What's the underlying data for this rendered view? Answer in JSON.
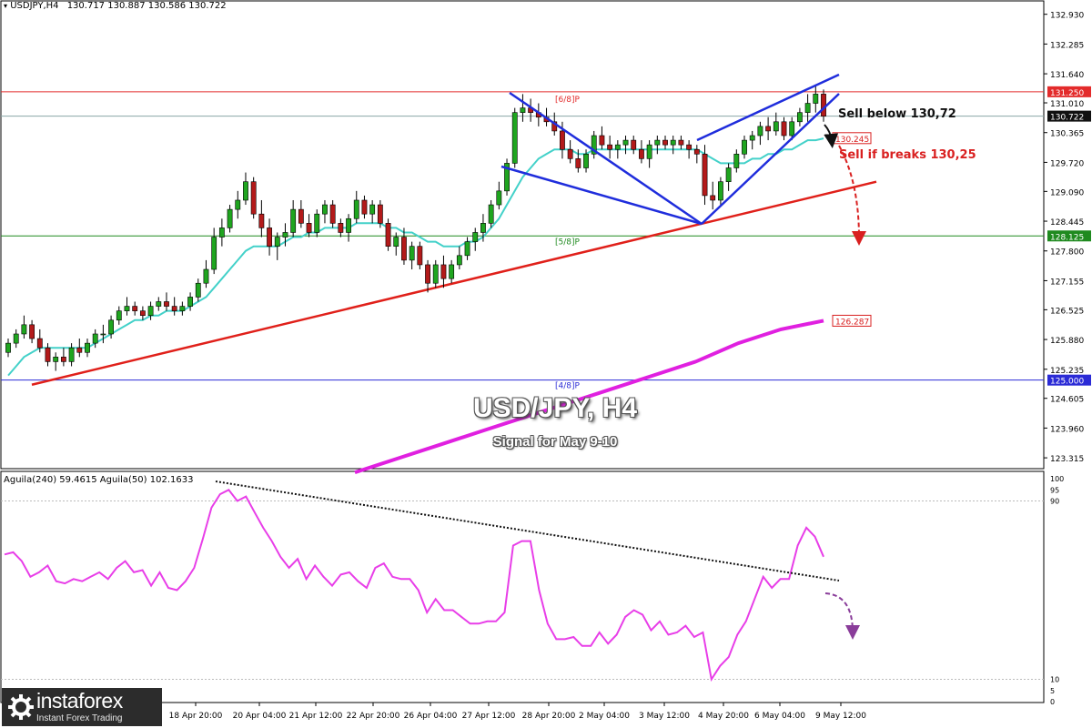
{
  "header": {
    "symbol": "USDJPY,H4",
    "ohlc": "130.717 130.887 130.586 130.722",
    "indicator_header": "Aguila(240) 59.4615  Aguila(50) 102.1633"
  },
  "watermark": {
    "title": "USD/JPY, H4",
    "subtitle": "Signal for May 9-10"
  },
  "logo": {
    "name": "instaforex",
    "tagline": "Instant Forex Trading"
  },
  "annotations": {
    "sell_below": "Sell below 130,72",
    "sell_if_breaks": "Sell if breaks 130,25"
  },
  "colors": {
    "resistance_line": "#e32b2b",
    "support_line": "#1f8a1f",
    "level_4_8": "#2b2bd6",
    "ema_fast": "#43d1c9",
    "ema_slow": "#e020e0",
    "wedge": "#1f2ddc",
    "trendline": "#e0201a",
    "candle_up": "#1fa51f",
    "candle_down": "#b31a1a",
    "oscillator": "#e83ee8",
    "annotation_red": "#d92020"
  },
  "chart_data": [
    {
      "type": "candlestick",
      "symbol": "USDJPY",
      "timeframe": "H4",
      "ylim": [
        123.1,
        133.2
      ],
      "y_ticks": [
        "132.930",
        "132.285",
        "131.640",
        "131.010",
        "130.365",
        "129.720",
        "129.090",
        "128.445",
        "127.800",
        "127.155",
        "126.525",
        "125.880",
        "125.235",
        "124.605",
        "123.960",
        "123.315"
      ],
      "x_ticks": [
        "18 Apr 20:00",
        "20 Apr 04:00",
        "21 Apr 12:00",
        "22 Apr 20:00",
        "26 Apr 04:00",
        "27 Apr 12:00",
        "28 Apr 20:00",
        "2 May 04:00",
        "3 May 12:00",
        "4 May 20:00",
        "6 May 04:00",
        "9 May 12:00"
      ],
      "levels": [
        {
          "name": "[6/8]P",
          "value": 131.25,
          "label": "131.250"
        },
        {
          "name": "[5/8]P",
          "value": 128.125,
          "label": "128.125"
        },
        {
          "name": "[4/8]P",
          "value": 125.0,
          "label": "125.000"
        }
      ],
      "price_labels": [
        {
          "value": 130.722,
          "label": "130.722"
        },
        {
          "value": 130.245,
          "label": "130.245"
        },
        {
          "value": 126.287,
          "label": "126.287"
        }
      ],
      "ohlc": [
        [
          125.6,
          125.9,
          125.5,
          125.8
        ],
        [
          125.8,
          126.1,
          125.7,
          126.0
        ],
        [
          126.0,
          126.4,
          125.9,
          126.2
        ],
        [
          126.2,
          126.3,
          125.8,
          125.9
        ],
        [
          125.9,
          126.1,
          125.6,
          125.7
        ],
        [
          125.7,
          125.8,
          125.3,
          125.4
        ],
        [
          125.4,
          125.6,
          125.2,
          125.5
        ],
        [
          125.5,
          125.7,
          125.3,
          125.4
        ],
        [
          125.4,
          125.8,
          125.3,
          125.7
        ],
        [
          125.7,
          125.9,
          125.5,
          125.6
        ],
        [
          125.6,
          125.9,
          125.5,
          125.8
        ],
        [
          125.8,
          126.1,
          125.7,
          126.0
        ],
        [
          126.0,
          126.2,
          125.8,
          126.0
        ],
        [
          126.0,
          126.4,
          125.9,
          126.3
        ],
        [
          126.3,
          126.6,
          126.2,
          126.5
        ],
        [
          126.5,
          126.8,
          126.4,
          126.6
        ],
        [
          126.6,
          126.7,
          126.4,
          126.5
        ],
        [
          126.5,
          126.6,
          126.3,
          126.4
        ],
        [
          126.4,
          126.7,
          126.3,
          126.6
        ],
        [
          126.6,
          126.8,
          126.5,
          126.7
        ],
        [
          126.7,
          126.9,
          126.5,
          126.6
        ],
        [
          126.6,
          126.8,
          126.4,
          126.5
        ],
        [
          126.5,
          126.7,
          126.4,
          126.6
        ],
        [
          126.6,
          126.9,
          126.5,
          126.8
        ],
        [
          126.8,
          127.2,
          126.7,
          127.1
        ],
        [
          127.1,
          127.6,
          127.0,
          127.4
        ],
        [
          127.4,
          128.3,
          127.3,
          128.1
        ],
        [
          128.1,
          128.5,
          127.9,
          128.3
        ],
        [
          128.3,
          128.8,
          128.2,
          128.7
        ],
        [
          128.7,
          129.1,
          128.5,
          128.9
        ],
        [
          128.9,
          129.5,
          128.8,
          129.3
        ],
        [
          129.3,
          129.4,
          128.5,
          128.6
        ],
        [
          128.6,
          128.9,
          128.1,
          128.3
        ],
        [
          128.3,
          128.5,
          127.7,
          127.9
        ],
        [
          127.9,
          128.2,
          127.6,
          128.1
        ],
        [
          128.1,
          128.4,
          127.9,
          128.2
        ],
        [
          128.2,
          128.9,
          128.1,
          128.7
        ],
        [
          128.7,
          128.9,
          128.3,
          128.4
        ],
        [
          128.4,
          128.6,
          128.1,
          128.2
        ],
        [
          128.2,
          128.7,
          128.1,
          128.6
        ],
        [
          128.6,
          128.9,
          128.4,
          128.8
        ],
        [
          128.8,
          128.9,
          128.3,
          128.4
        ],
        [
          128.4,
          128.5,
          128.1,
          128.2
        ],
        [
          128.2,
          128.6,
          128.0,
          128.5
        ],
        [
          128.5,
          129.1,
          128.4,
          128.9
        ],
        [
          128.9,
          129.0,
          128.5,
          128.6
        ],
        [
          128.6,
          128.9,
          128.4,
          128.8
        ],
        [
          128.8,
          128.9,
          128.3,
          128.4
        ],
        [
          128.4,
          128.5,
          127.8,
          127.9
        ],
        [
          127.9,
          128.2,
          127.7,
          128.1
        ],
        [
          128.1,
          128.3,
          127.5,
          127.6
        ],
        [
          127.6,
          128.0,
          127.4,
          127.9
        ],
        [
          127.9,
          128.0,
          127.4,
          127.5
        ],
        [
          127.5,
          127.6,
          126.9,
          127.1
        ],
        [
          127.1,
          127.6,
          127.0,
          127.5
        ],
        [
          127.5,
          127.7,
          127.0,
          127.2
        ],
        [
          127.2,
          127.6,
          127.1,
          127.5
        ],
        [
          127.5,
          127.9,
          127.4,
          127.7
        ],
        [
          127.7,
          128.1,
          127.6,
          128.0
        ],
        [
          128.0,
          128.3,
          127.8,
          128.2
        ],
        [
          128.2,
          128.6,
          128.0,
          128.4
        ],
        [
          128.4,
          128.9,
          128.3,
          128.8
        ],
        [
          128.8,
          129.3,
          128.7,
          129.1
        ],
        [
          129.1,
          129.8,
          129.0,
          129.7
        ],
        [
          129.7,
          130.9,
          129.6,
          130.8
        ],
        [
          130.8,
          131.2,
          130.6,
          130.9
        ],
        [
          130.9,
          131.1,
          130.6,
          130.8
        ],
        [
          130.8,
          131.0,
          130.5,
          130.7
        ],
        [
          130.7,
          130.9,
          130.5,
          130.6
        ],
        [
          130.6,
          130.8,
          130.3,
          130.4
        ],
        [
          130.4,
          130.6,
          129.8,
          130.0
        ],
        [
          130.0,
          130.2,
          129.7,
          129.8
        ],
        [
          129.8,
          130.0,
          129.5,
          129.6
        ],
        [
          129.6,
          130.0,
          129.5,
          129.9
        ],
        [
          129.9,
          130.4,
          129.8,
          130.3
        ],
        [
          130.3,
          130.5,
          130.0,
          130.1
        ],
        [
          130.1,
          130.3,
          129.8,
          130.0
        ],
        [
          130.0,
          130.2,
          129.8,
          130.1
        ],
        [
          130.1,
          130.3,
          129.9,
          130.2
        ],
        [
          130.2,
          130.3,
          129.9,
          130.0
        ],
        [
          130.0,
          130.2,
          129.7,
          129.8
        ],
        [
          129.8,
          130.2,
          129.6,
          130.1
        ],
        [
          130.1,
          130.3,
          129.9,
          130.2
        ],
        [
          130.2,
          130.3,
          130.0,
          130.1
        ],
        [
          130.1,
          130.3,
          129.9,
          130.2
        ],
        [
          130.2,
          130.3,
          130.0,
          130.1
        ],
        [
          130.1,
          130.2,
          129.8,
          130.0
        ],
        [
          130.0,
          130.1,
          129.7,
          129.9
        ],
        [
          129.9,
          130.1,
          128.8,
          129.0
        ],
        [
          129.0,
          129.3,
          128.7,
          128.9
        ],
        [
          128.9,
          129.4,
          128.8,
          129.3
        ],
        [
          129.3,
          129.7,
          129.1,
          129.6
        ],
        [
          129.6,
          130.0,
          129.5,
          129.9
        ],
        [
          129.9,
          130.3,
          129.8,
          130.2
        ],
        [
          130.2,
          130.4,
          130.0,
          130.3
        ],
        [
          130.3,
          130.6,
          130.1,
          130.5
        ],
        [
          130.5,
          130.7,
          130.2,
          130.4
        ],
        [
          130.4,
          130.8,
          130.3,
          130.6
        ],
        [
          130.6,
          130.7,
          130.2,
          130.3
        ],
        [
          130.3,
          130.7,
          130.2,
          130.6
        ],
        [
          130.6,
          130.9,
          130.5,
          130.8
        ],
        [
          130.8,
          131.2,
          130.6,
          131.0
        ],
        [
          131.0,
          131.4,
          130.8,
          131.2
        ],
        [
          131.2,
          131.3,
          130.6,
          130.72
        ]
      ],
      "ema_fast": [
        125.1,
        125.3,
        125.5,
        125.6,
        125.7,
        125.7,
        125.7,
        125.7,
        125.7,
        125.7,
        125.7,
        125.8,
        125.9,
        126.0,
        126.1,
        126.2,
        126.3,
        126.3,
        126.4,
        126.4,
        126.5,
        126.5,
        126.5,
        126.6,
        126.7,
        126.8,
        127.0,
        127.2,
        127.4,
        127.6,
        127.8,
        127.9,
        127.9,
        127.9,
        127.9,
        128.0,
        128.1,
        128.1,
        128.2,
        128.2,
        128.3,
        128.3,
        128.3,
        128.3,
        128.4,
        128.4,
        128.4,
        128.4,
        128.3,
        128.3,
        128.2,
        128.2,
        128.1,
        128.0,
        128.0,
        127.9,
        127.9,
        127.9,
        128.0,
        128.0,
        128.1,
        128.3,
        128.5,
        128.8,
        129.1,
        129.4,
        129.6,
        129.8,
        129.9,
        130.0,
        130.0,
        130.0,
        129.9,
        129.9,
        130.0,
        130.0,
        130.0,
        130.0,
        130.0,
        130.0,
        130.0,
        130.0,
        130.0,
        130.0,
        130.0,
        130.0,
        130.0,
        130.0,
        129.9,
        129.8,
        129.7,
        129.7,
        129.7,
        129.7,
        129.8,
        129.8,
        129.9,
        129.9,
        130.0,
        130.0,
        130.1,
        130.2,
        130.2,
        130.24
      ],
      "ema_slow": [
        [
          122.6,
          123.0
        ],
        [
          123.0,
          123.3
        ],
        [
          123.4,
          123.6
        ],
        [
          123.8,
          123.9
        ],
        [
          124.2,
          124.2
        ],
        [
          124.6,
          124.5
        ],
        [
          125.0,
          124.8
        ],
        [
          125.4,
          125.1
        ],
        [
          125.8,
          125.4
        ],
        [
          126.2,
          125.8
        ],
        [
          126.6,
          126.1
        ],
        [
          127.0,
          126.287
        ]
      ],
      "wedges": [
        {
          "name": "broadening-left",
          "upper": [
            [
              27.5,
              131.3
            ],
            [
              47,
              129.4
            ]
          ],
          "lower": [
            [
              27,
              129.6
            ],
            [
              47,
              128.8
            ]
          ]
        },
        {
          "name": "rising-right",
          "upper": [
            [
              47,
              128.8
            ],
            [
              61,
              131.5
            ]
          ],
          "lower": [
            [
              47,
              128.8
            ],
            [
              60,
              131.4
            ]
          ]
        }
      ],
      "trendline": [
        [
          0,
          124.9
        ],
        [
          66,
          129.3
        ]
      ]
    },
    {
      "type": "line",
      "name": "Aguila",
      "ylim": [
        0,
        100
      ],
      "levels": [
        5,
        10,
        90,
        95,
        100
      ],
      "level_labels": [
        "100",
        "95",
        "90",
        "10",
        "5",
        "0"
      ],
      "values": [
        66,
        67,
        63,
        56,
        58,
        61,
        54,
        53,
        55,
        54,
        56,
        58,
        55,
        60,
        63,
        58,
        59,
        52,
        58,
        51,
        50,
        54,
        60,
        73,
        87,
        93,
        95,
        90,
        92,
        85,
        78,
        72,
        65,
        60,
        64,
        55,
        61,
        56,
        52,
        57,
        58,
        54,
        51,
        60,
        62,
        56,
        55,
        55,
        50,
        40,
        46,
        41,
        41,
        38,
        35,
        35,
        36,
        36,
        40,
        70,
        72,
        72,
        50,
        35,
        28,
        28,
        29,
        25,
        25,
        31,
        26,
        30,
        38,
        41,
        39,
        32,
        36,
        30,
        31,
        34,
        29,
        31,
        10,
        16,
        20,
        30,
        36,
        46,
        56,
        51,
        55,
        55,
        70,
        78,
        74,
        65
      ],
      "trendline": [
        [
          0,
          98
        ],
        [
          1,
          60
        ]
      ],
      "projection": "down"
    }
  ]
}
